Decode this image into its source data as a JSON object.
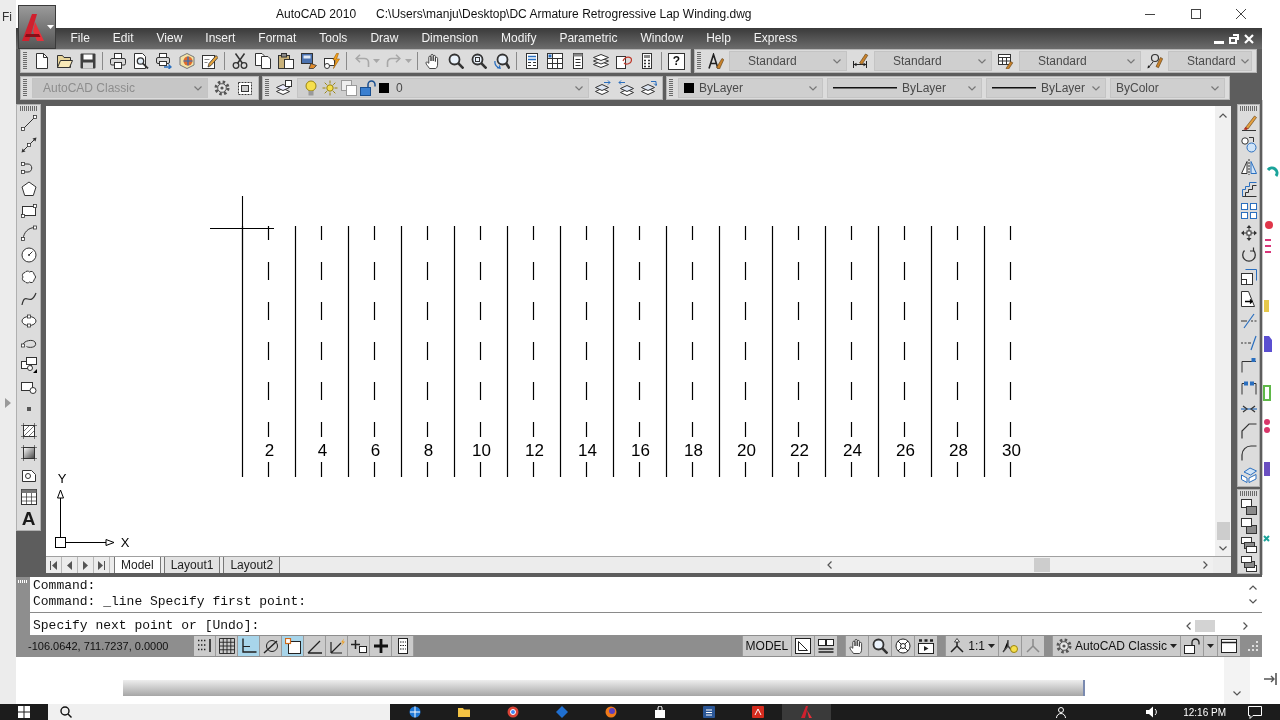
{
  "desktop": {
    "behind_window_text": "Fi"
  },
  "window": {
    "app_title": "AutoCAD 2010",
    "file_path": "C:\\Users\\manju\\Desktop\\DC Armature Retrogressive Lap Winding.dwg"
  },
  "menu_bar": {
    "items": [
      "File",
      "Edit",
      "View",
      "Insert",
      "Format",
      "Tools",
      "Draw",
      "Dimension",
      "Modify",
      "Parametric",
      "Window",
      "Help",
      "Express"
    ]
  },
  "standard_toolbar": {
    "history_buttons": [
      {
        "kind": "undo",
        "disabled": true
      },
      {
        "kind": "redo",
        "disabled": true
      }
    ],
    "help_glyph": "?"
  },
  "styles_toolbar": [
    {
      "kind": "text",
      "value": "Standard"
    },
    {
      "kind": "dimension",
      "value": "Standard"
    },
    {
      "kind": "table",
      "value": "Standard"
    },
    {
      "kind": "multileader",
      "value": "Standard"
    }
  ],
  "workspaces_toolbar": {
    "value": "AutoCAD Classic",
    "disabled": true
  },
  "layers_toolbar": {
    "current_layer": "0"
  },
  "properties_toolbar": [
    {
      "kind": "color",
      "value": "ByLayer"
    },
    {
      "kind": "linetype",
      "value": "ByLayer"
    },
    {
      "kind": "lineweight",
      "value": "ByLayer"
    },
    {
      "kind": "plot_style",
      "value": "ByColor"
    }
  ],
  "draw_toolbar": {
    "text_glyph": "A"
  },
  "drawing": {
    "slot_numbers": [
      "2",
      "4",
      "6",
      "8",
      "10",
      "12",
      "14",
      "16",
      "18",
      "20",
      "22",
      "24",
      "26",
      "28",
      "30"
    ],
    "ucs": {
      "y_label": "Y",
      "x_label": "X"
    }
  },
  "layout_tabs": [
    {
      "label": "Model",
      "selected": true
    },
    {
      "label": "Layout1",
      "selected": false
    },
    {
      "label": "Layout2",
      "selected": false
    }
  ],
  "command_window": {
    "history": [
      "Command:",
      "Command: _line Specify first point:"
    ],
    "prompt": "Specify next point or [Undo]:"
  },
  "status_bar": {
    "coordinates": "-106.0642, 711.7237, 0.0000",
    "toggles": [
      {
        "kind": "snap",
        "on": false
      },
      {
        "kind": "grid",
        "on": false
      },
      {
        "kind": "ortho",
        "on": true
      },
      {
        "kind": "polar",
        "on": false
      },
      {
        "kind": "osnap",
        "on": true
      },
      {
        "kind": "otrack",
        "on": false
      },
      {
        "kind": "ducs",
        "on": false
      },
      {
        "kind": "dyn",
        "on": false
      },
      {
        "kind": "lwt",
        "on": false
      },
      {
        "kind": "qp",
        "on": false
      }
    ],
    "space": "MODEL",
    "annotation_scale": "1:1",
    "workspace": "AutoCAD Classic"
  },
  "taskbar": {
    "clock": "12:16 PM"
  }
}
